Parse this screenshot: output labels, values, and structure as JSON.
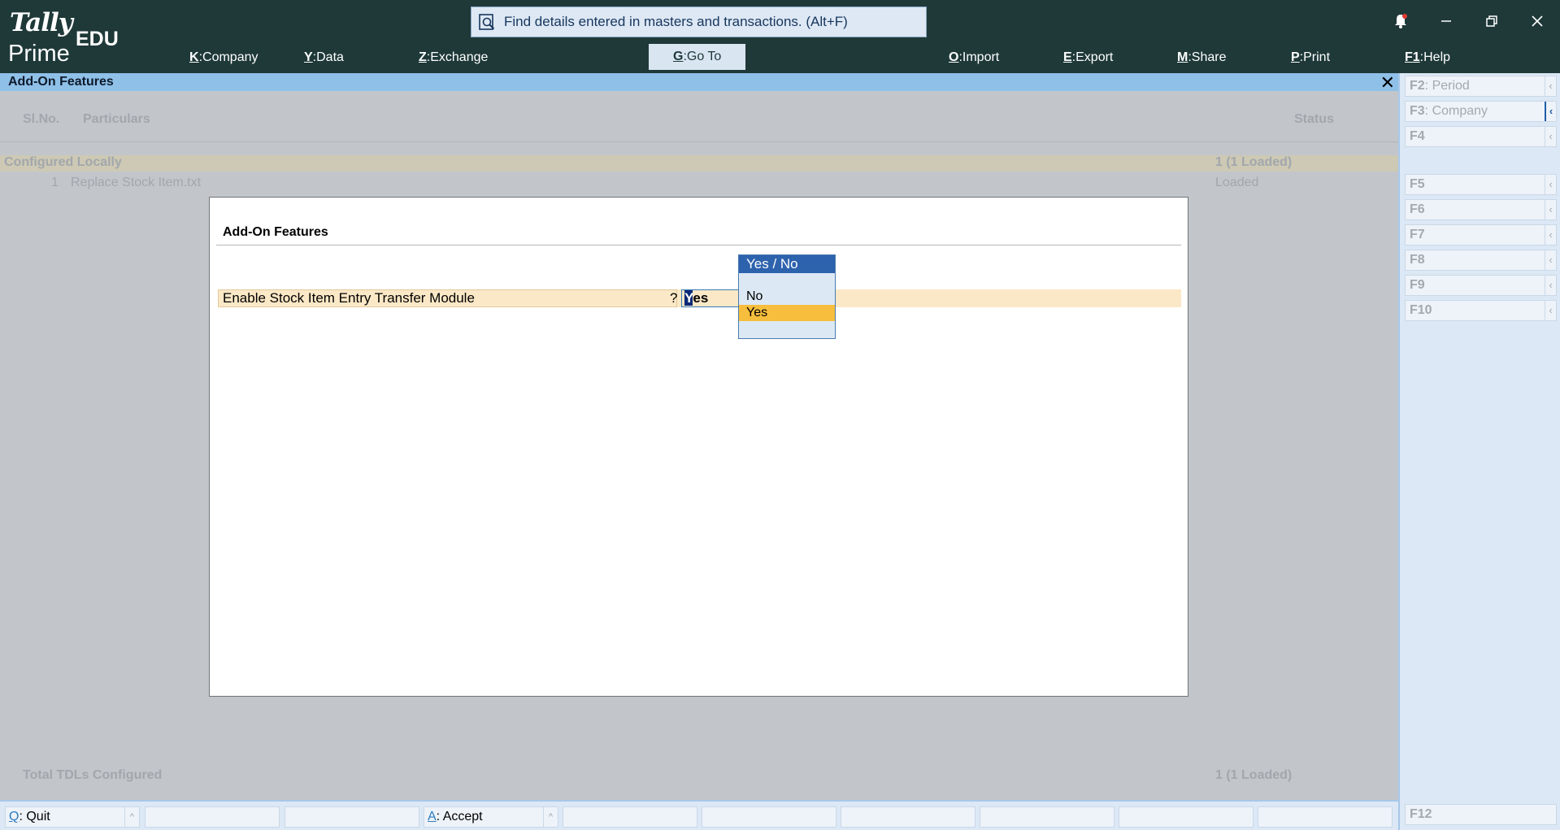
{
  "app": {
    "logo_tally": "Tally",
    "logo_prime": "Prime",
    "edition": "EDU",
    "search_placeholder": "Find details entered in masters and transactions. (Alt+F)"
  },
  "menu": [
    {
      "key": "K",
      "label": "Company"
    },
    {
      "key": "Y",
      "label": "Data"
    },
    {
      "key": "Z",
      "label": "Exchange"
    },
    {
      "key": "G",
      "label": "Go To"
    },
    {
      "key": "O",
      "label": "Import"
    },
    {
      "key": "E",
      "label": "Export"
    },
    {
      "key": "M",
      "label": "Share"
    },
    {
      "key": "P",
      "label": "Print"
    },
    {
      "key": "F1",
      "label": "Help"
    }
  ],
  "window": {
    "title": "Add-On Features",
    "close_glyph": "✕"
  },
  "report": {
    "col_slno": "Sl.No.",
    "col_particulars": "Particulars",
    "col_status": "Status",
    "group_label": "Configured Locally",
    "group_status": "1 (1 Loaded)",
    "item_no": "1",
    "item_name": "Replace Stock Item.txt",
    "item_status": "Loaded",
    "total_label": "Total TDLs Configured",
    "total_status": "1 (1 Loaded)"
  },
  "modal": {
    "title": "Add-On Features",
    "field_label": "Enable Stock Item Entry Transfer Module",
    "field_q": "?",
    "field_value_first": "Y",
    "field_value_rest": "es"
  },
  "dropdown": {
    "header": "Yes / No",
    "options": [
      "No",
      "Yes"
    ],
    "selected": "Yes"
  },
  "fkeys": [
    {
      "key": "F2",
      "label": "Period"
    },
    {
      "key": "F3",
      "label": "Company"
    },
    {
      "key": "F4",
      "label": ""
    },
    {
      "key": "F5",
      "label": ""
    },
    {
      "key": "F6",
      "label": ""
    },
    {
      "key": "F7",
      "label": ""
    },
    {
      "key": "F8",
      "label": ""
    },
    {
      "key": "F9",
      "label": ""
    },
    {
      "key": "F10",
      "label": ""
    },
    {
      "key": "F12",
      "label": ""
    }
  ],
  "bottom_buttons": [
    {
      "key": "Q",
      "label": "Quit"
    },
    {
      "key": "A",
      "label": "Accept"
    }
  ],
  "colors": {
    "header_bg": "#1f3939",
    "title_bar": "#8fc0e8",
    "highlight_row": "#fbe8c6",
    "selected_option": "#f6be3c",
    "dropdown_header": "#2d62ad"
  }
}
